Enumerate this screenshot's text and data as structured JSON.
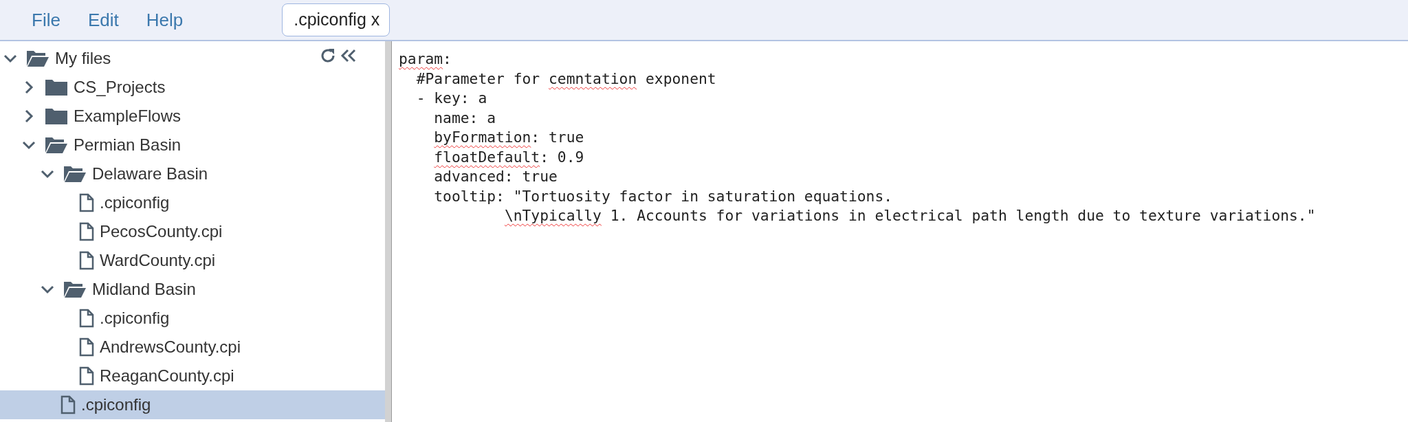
{
  "menu": [
    {
      "label": "File"
    },
    {
      "label": "Edit"
    },
    {
      "label": "Help"
    }
  ],
  "tabs": [
    {
      "label": ".cpiconfig x",
      "selected": true
    }
  ],
  "tree": {
    "items": [
      {
        "kind": "folder",
        "label": "My files",
        "expanded": true,
        "selected": false,
        "children": [
          {
            "kind": "folder",
            "label": "CS_Projects",
            "expanded": false,
            "selected": false
          },
          {
            "kind": "folder",
            "label": "ExampleFlows",
            "expanded": false,
            "selected": false
          },
          {
            "kind": "folder",
            "label": "Permian Basin",
            "expanded": true,
            "selected": false,
            "children": [
              {
                "kind": "folder",
                "label": "Delaware Basin",
                "expanded": true,
                "selected": false,
                "children": [
                  {
                    "kind": "file",
                    "label": ".cpiconfig",
                    "selected": false
                  },
                  {
                    "kind": "file",
                    "label": "PecosCounty.cpi",
                    "selected": false
                  },
                  {
                    "kind": "file",
                    "label": "WardCounty.cpi",
                    "selected": false
                  }
                ]
              },
              {
                "kind": "folder",
                "label": "Midland Basin",
                "expanded": true,
                "selected": false,
                "children": [
                  {
                    "kind": "file",
                    "label": ".cpiconfig",
                    "selected": false
                  },
                  {
                    "kind": "file",
                    "label": "AndrewsCounty.cpi",
                    "selected": false
                  },
                  {
                    "kind": "file",
                    "label": "ReaganCounty.cpi",
                    "selected": false
                  }
                ]
              },
              {
                "kind": "file",
                "label": ".cpiconfig",
                "selected": true
              }
            ]
          }
        ]
      }
    ]
  },
  "editor": {
    "lines": [
      [
        {
          "text": "param",
          "misspelled": true
        },
        {
          "text": ":",
          "misspelled": false
        }
      ],
      [
        {
          "text": "  #Parameter for ",
          "misspelled": false
        },
        {
          "text": "cemntation",
          "misspelled": true
        },
        {
          "text": " exponent",
          "misspelled": false
        }
      ],
      [
        {
          "text": "  - key: a",
          "misspelled": false
        }
      ],
      [
        {
          "text": "    name: a",
          "misspelled": false
        }
      ],
      [
        {
          "text": "    byFormation",
          "misspelled": true
        },
        {
          "text": ": true",
          "misspelled": false
        }
      ],
      [
        {
          "text": "    floatDefault",
          "misspelled": true
        },
        {
          "text": ": 0.9",
          "misspelled": false
        }
      ],
      [
        {
          "text": "    advanced: true",
          "misspelled": false
        }
      ],
      [
        {
          "text": "    tooltip: \"Tortuosity factor in saturation equations.",
          "misspelled": false
        }
      ],
      [
        {
          "text": "            \\nTypically",
          "misspelled": true
        },
        {
          "text": " 1. Accounts for variations in electrical path length due to texture variations.\"",
          "misspelled": false
        }
      ]
    ]
  }
}
